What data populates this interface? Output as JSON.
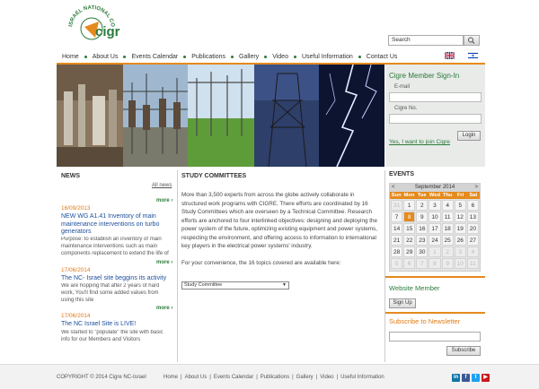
{
  "logo": {
    "arc_text": "ISRAEL NATIONAL COMMITTEE",
    "brand": "cigré"
  },
  "search": {
    "placeholder": "Search"
  },
  "nav": {
    "items": [
      "Home",
      "About Us",
      "Events Calendar",
      "Publications",
      "Gallery",
      "Video",
      "Useful Information",
      "Contact Us"
    ]
  },
  "signin": {
    "title": "Cigre Member Sign-In",
    "email_label": "E-mail",
    "cigre_no_label": "Cigre No.",
    "login_label": "Login",
    "join_link": "Yes, I want to join Cigre"
  },
  "news": {
    "title": "NEWS",
    "all_label": "All news",
    "more_label": "more",
    "items": [
      {
        "date": "16/09/2013",
        "headline": "NEW WG A1.41 Inventory of main maintenance interventions on turbo generators",
        "body": "Purpose: to establish an inventory of main maintenance interventions such as main components replacement to extend the life of"
      },
      {
        "date": "17/06/2014",
        "headline": "The NC- Israel site beggins its activity",
        "body": "We are hopping that after 2 years of hard work, You'll find some added values from using this site"
      },
      {
        "date": "17/06/2014",
        "headline": "The NC Israel Site is LIVE!",
        "body": "We started to \"populate\" the site with basic info for our Members and Visitors"
      }
    ]
  },
  "study": {
    "title": "STUDY COMMITTEES",
    "para1": "More than 3,500 experts from across the globe actively collaborate in structured work programs with CIGRE. There efforts are coordinated by 16 Study Committees which are overseen by a Technical Committee. Research efforts are anchored to four interlinked objectives: designing and deploying the power system of the future, optimizing existing equipment and power systems, respecting the environment, and offering access to information to international key players in the electrical power systems' industry.",
    "para2": "For your convenience, the 16 topics covered are available here:",
    "select_value": "Study Committee"
  },
  "events": {
    "title": "EVENTS",
    "month": "September 2014",
    "prev": "<",
    "next": ">",
    "days": [
      "Sun",
      "Mon",
      "Tue",
      "Wed",
      "Thu",
      "Fri",
      "Sat"
    ],
    "cells": [
      {
        "d": "31",
        "out": true
      },
      {
        "d": "1"
      },
      {
        "d": "2"
      },
      {
        "d": "3"
      },
      {
        "d": "4"
      },
      {
        "d": "5"
      },
      {
        "d": "6"
      },
      {
        "d": "7"
      },
      {
        "d": "8",
        "today": true
      },
      {
        "d": "9"
      },
      {
        "d": "10"
      },
      {
        "d": "11"
      },
      {
        "d": "12"
      },
      {
        "d": "13"
      },
      {
        "d": "14"
      },
      {
        "d": "15"
      },
      {
        "d": "16"
      },
      {
        "d": "17"
      },
      {
        "d": "18"
      },
      {
        "d": "19"
      },
      {
        "d": "20"
      },
      {
        "d": "21"
      },
      {
        "d": "22"
      },
      {
        "d": "23"
      },
      {
        "d": "24"
      },
      {
        "d": "25"
      },
      {
        "d": "26"
      },
      {
        "d": "27"
      },
      {
        "d": "28"
      },
      {
        "d": "29"
      },
      {
        "d": "30"
      },
      {
        "d": "1",
        "out": true
      },
      {
        "d": "2",
        "out": true
      },
      {
        "d": "3",
        "out": true
      },
      {
        "d": "4",
        "out": true
      },
      {
        "d": "5",
        "out": true
      },
      {
        "d": "6",
        "out": true
      },
      {
        "d": "7",
        "out": true
      },
      {
        "d": "8",
        "out": true
      },
      {
        "d": "9",
        "out": true
      },
      {
        "d": "10",
        "out": true
      },
      {
        "d": "11",
        "out": true
      }
    ]
  },
  "website_member": {
    "title": "Website Member",
    "signup_label": "Sign Up"
  },
  "newsletter": {
    "title": "Subscribe to Newsletter",
    "subscribe_label": "Subscribe"
  },
  "footer": {
    "copyright": "COPYRIGHT © 2014 Cigre NC-Israel",
    "links": [
      "Home",
      "About Us",
      "Events Calendar",
      "Publications",
      "Gallery",
      "Video",
      "Useful Information"
    ]
  },
  "social": [
    {
      "name": "linkedin-icon",
      "glyph": "in",
      "color": "#0e76a8"
    },
    {
      "name": "facebook-icon",
      "glyph": "f",
      "color": "#3b5998"
    },
    {
      "name": "twitter-icon",
      "glyph": "t",
      "color": "#1da1f2"
    },
    {
      "name": "youtube-icon",
      "glyph": "▶",
      "color": "#cc181e"
    }
  ],
  "colors": {
    "accent": "#e58a1c",
    "brand_green": "#2a7a3a",
    "link_blue": "#1d4e9a"
  }
}
